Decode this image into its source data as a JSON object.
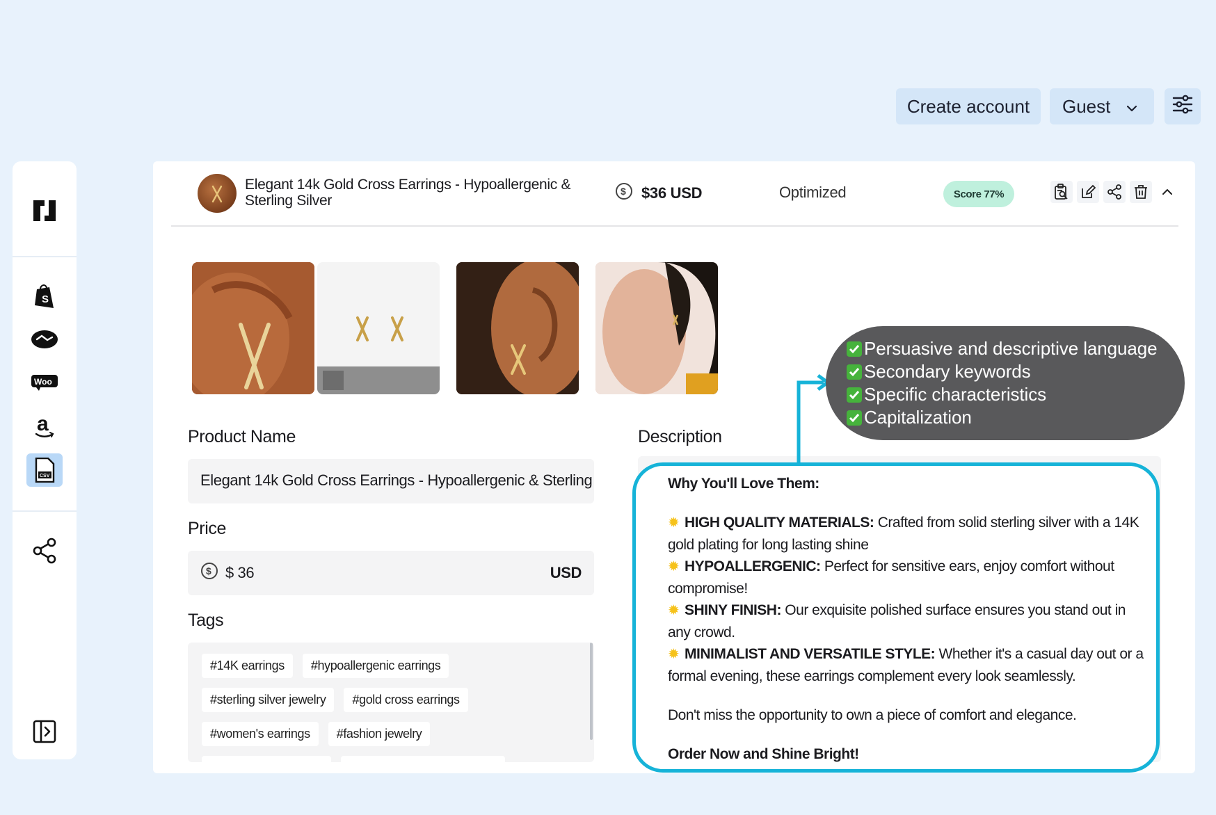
{
  "topbar": {
    "create_account": "Create account",
    "guest": "Guest"
  },
  "sidebar": {
    "items": [
      "brand-logo-icon",
      "shopify-icon",
      "handshake-icon",
      "woocommerce-icon",
      "amazon-icon",
      "csv-file-icon",
      "share-icon",
      "collapse-panel-icon"
    ],
    "woo_text": "Woo",
    "csv_text": "CSV"
  },
  "product": {
    "title": "Elegant 14k Gold Cross Earrings - Hypoallergenic & Sterling Silver",
    "price_summary": "$36 USD",
    "status": "Optimized",
    "score": "Score 77%"
  },
  "form": {
    "name_label": "Product Name",
    "name_value": "Elegant 14k Gold Cross Earrings - Hypoallergenic & Sterling",
    "price_label": "Price",
    "price_value": "$ 36",
    "price_currency": "USD",
    "tags_label": "Tags",
    "tags": [
      "#14K earrings",
      "#hypoallergenic earrings",
      "#sterling silver jewelry",
      "#gold cross earrings",
      "#women's earrings",
      "#fashion jewelry"
    ],
    "description_label": "Description"
  },
  "description": {
    "heading": "Why You'll Love Them:",
    "bullets": [
      {
        "title": "HIGH QUALITY MATERIALS:",
        "text": " Crafted from solid sterling silver with a 14K gold plating for long lasting shine"
      },
      {
        "title": "HYPOALLERGENIC:",
        "text": " Perfect for sensitive ears, enjoy comfort without compromise!"
      },
      {
        "title": "SHINY FINISH:",
        "text": " Our exquisite polished surface ensures you stand out in any crowd."
      },
      {
        "title": "MINIMALIST AND VERSATILE STYLE:",
        "text": " Whether it's a casual day out or a formal evening, these earrings complement every look seamlessly."
      }
    ],
    "closing": "Don't miss the opportunity to own a piece of comfort and elegance.",
    "cta": "Order Now and Shine Bright!"
  },
  "checklist": [
    "Persuasive and descriptive language",
    "Secondary keywords",
    "Specific characteristics",
    "Capitalization"
  ],
  "colors": {
    "background": "#e8f2fc",
    "callout_border": "#16b3d8",
    "score_badge": "#bff0dd",
    "bubble": "#59595b"
  }
}
